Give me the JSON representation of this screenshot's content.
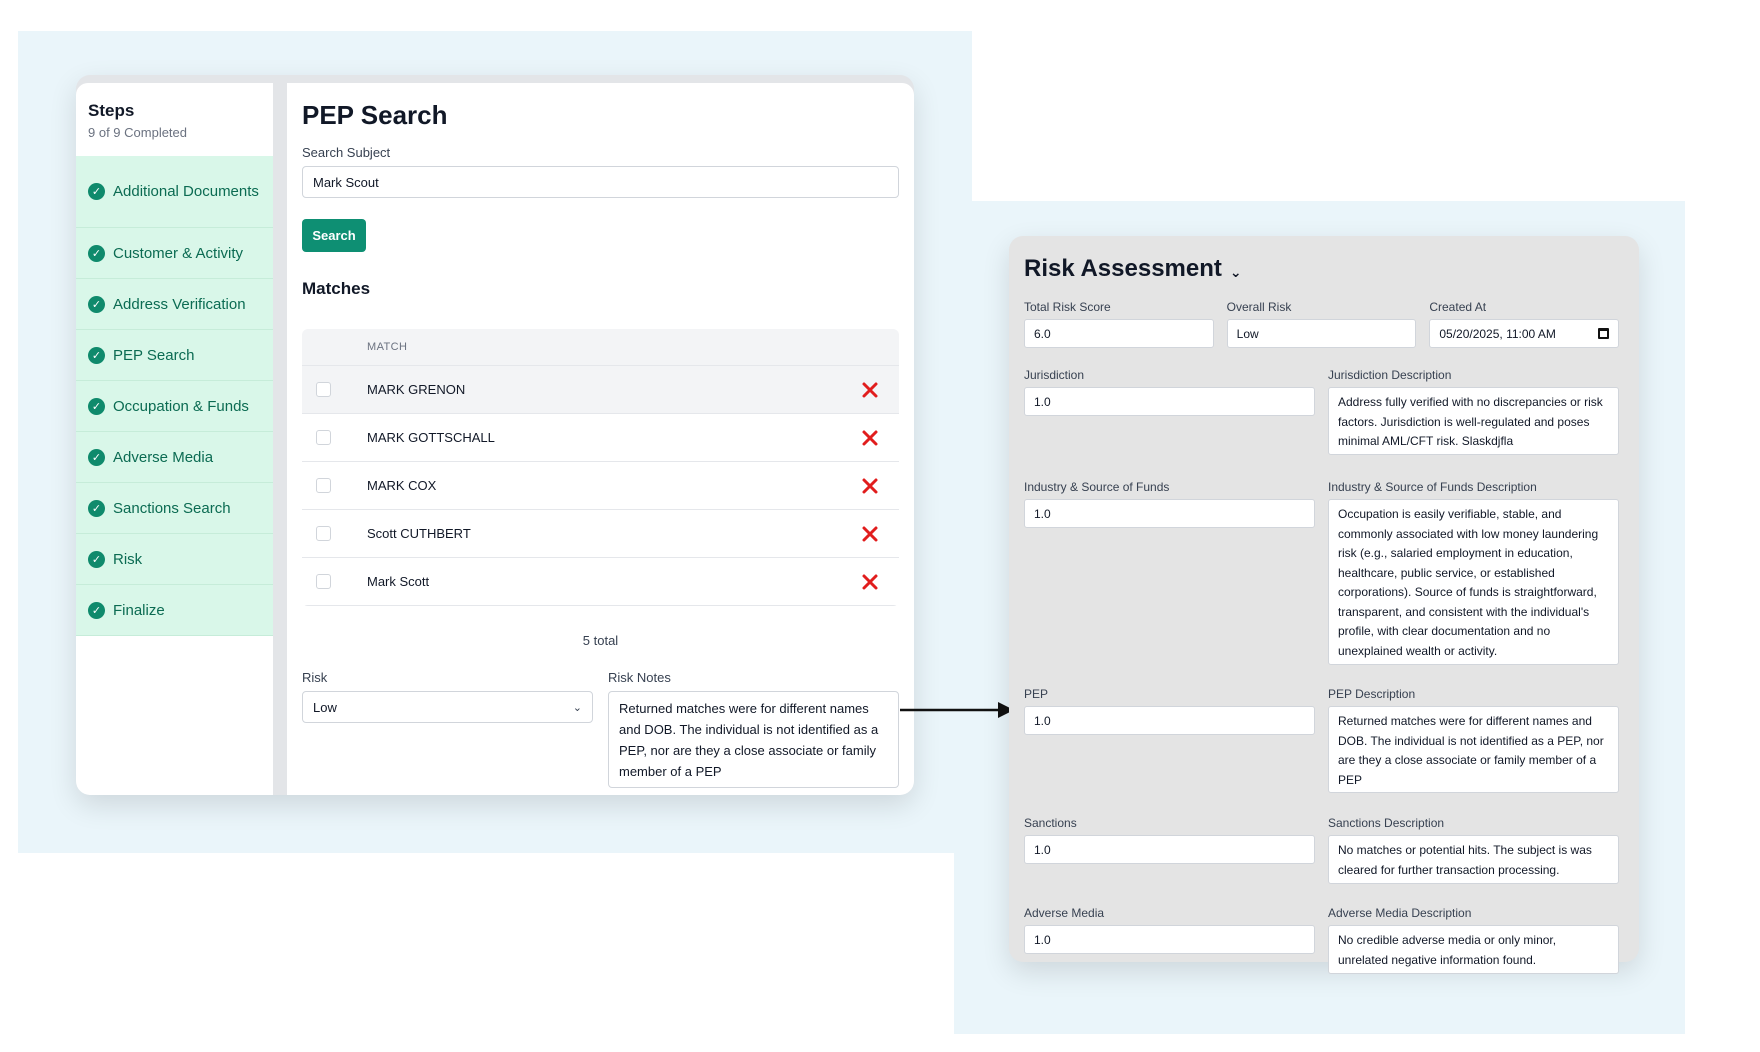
{
  "steps": {
    "title": "Steps",
    "subtitle": "9 of 9 Completed",
    "items": [
      {
        "label": "Additional Documents"
      },
      {
        "label": "Customer & Activity"
      },
      {
        "label": "Address Verification"
      },
      {
        "label": "PEP Search"
      },
      {
        "label": "Occupation & Funds"
      },
      {
        "label": "Adverse Media"
      },
      {
        "label": "Sanctions Search"
      },
      {
        "label": "Risk"
      },
      {
        "label": "Finalize"
      }
    ]
  },
  "pep": {
    "title": "PEP Search",
    "search_label": "Search Subject",
    "search_value": "Mark Scout",
    "search_button": "Search",
    "matches_title": "Matches",
    "column_header": "MATCH",
    "matches": [
      {
        "name": "MARK GRENON"
      },
      {
        "name": "MARK GOTTSCHALL"
      },
      {
        "name": "MARK COX"
      },
      {
        "name": "Scott CUTHBERT"
      },
      {
        "name": "Mark Scott"
      }
    ],
    "total": "5 total",
    "risk_label": "Risk",
    "risk_value": "Low",
    "notes_label": "Risk Notes",
    "notes_value": "Returned matches were for different names and DOB. The individual is not identified as a PEP, nor are they a close associate or family member of a PEP"
  },
  "risk": {
    "title": "Risk Assessment",
    "total_label": "Total Risk Score",
    "total_value": "6.0",
    "overall_label": "Overall Risk",
    "overall_value": "Low",
    "created_label": "Created At",
    "created_value": "05/20/2025, 11:00 AM",
    "rows": [
      {
        "label": "Jurisdiction",
        "value": "1.0",
        "desc_label": "Jurisdiction Description",
        "desc": "Address fully verified with no discrepancies or risk factors. Jurisdiction is well-regulated and poses minimal AML/CFT risk. Slaskdjfla"
      },
      {
        "label": "Industry & Source of Funds",
        "value": "1.0",
        "desc_label": "Industry & Source of Funds Description",
        "desc": "Occupation is easily verifiable, stable, and commonly associated with low money laundering risk (e.g., salaried employment in education, healthcare, public service, or established corporations). Source of funds is straightforward, transparent, and consistent with the individual's profile, with clear documentation and no unexplained wealth or activity."
      },
      {
        "label": "PEP",
        "value": "1.0",
        "desc_label": "PEP Description",
        "desc": "Returned matches were for different names and DOB. The individual is not identified as a PEP, nor are they a close associate or family member of a PEP"
      },
      {
        "label": "Sanctions",
        "value": "1.0",
        "desc_label": "Sanctions Description",
        "desc": "No matches or potential hits. The subject is was cleared for further transaction processing."
      },
      {
        "label": "Adverse Media",
        "value": "1.0",
        "desc_label": "Adverse Media Description",
        "desc": "No credible adverse media or only minor, unrelated negative information found."
      }
    ]
  }
}
